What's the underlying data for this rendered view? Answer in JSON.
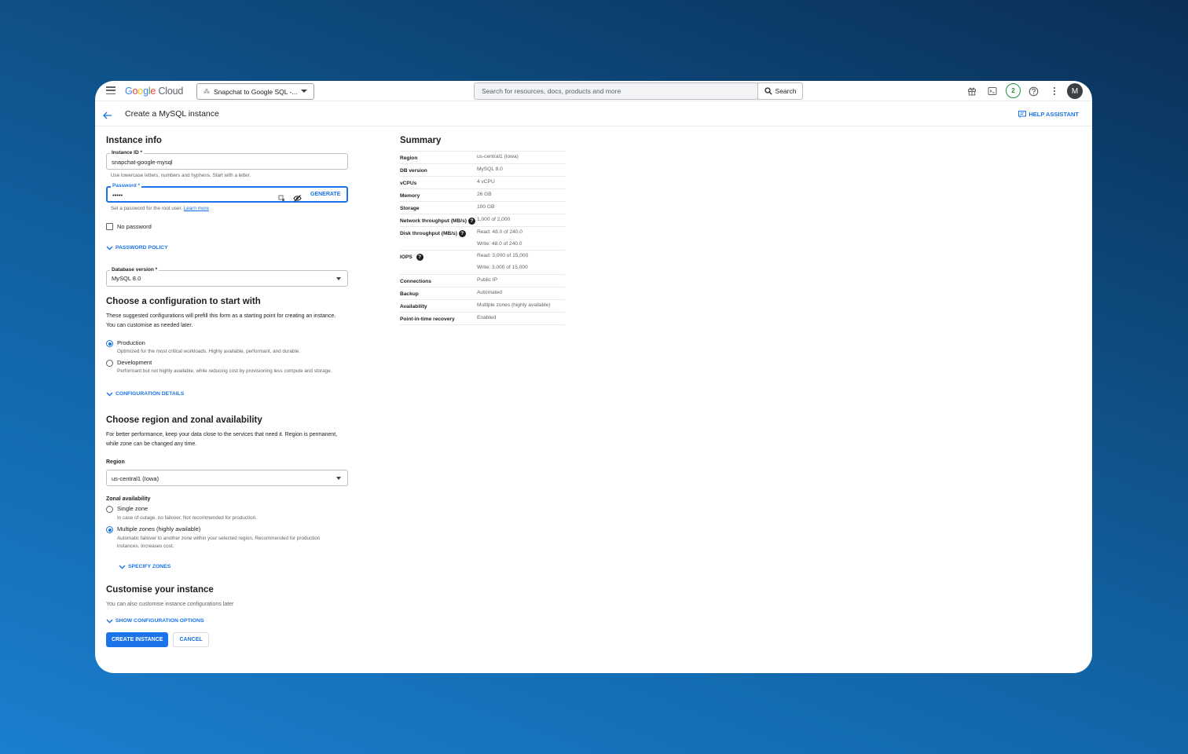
{
  "topbar": {
    "logo_google": "Google",
    "logo_cloud": "Cloud",
    "project": "Snapchat to Google SQL -...",
    "search_placeholder": "Search for resources, docs, products and more",
    "search_button": "Search",
    "notifications_count": "2",
    "avatar_letter": "M"
  },
  "page": {
    "title": "Create a MySQL instance",
    "help_assistant": "HELP ASSISTANT"
  },
  "instance_info": {
    "heading": "Instance info",
    "id_label": "Instance ID *",
    "id_value": "snapchat-google-mysql",
    "id_hint": "Use lowercase letters, numbers and hyphens. Start with a letter.",
    "password_label": "Password *",
    "password_value": "•••••",
    "generate": "GENERATE",
    "password_hint": "Set a password for the root user.",
    "learn_more": "Learn more",
    "no_password": "No password",
    "password_policy": "PASSWORD POLICY",
    "db_version_label": "Database version *",
    "db_version_value": "MySQL 8.0"
  },
  "config": {
    "heading": "Choose a configuration to start with",
    "description": "These suggested configurations will prefill this form as a starting point for creating an instance. You can customise as needed later.",
    "options": [
      {
        "label": "Production",
        "desc": "Optimized for the most critical workloads. Highly available, performant, and durable.",
        "selected": true
      },
      {
        "label": "Development",
        "desc": "Performant but not highly available, while reducing cost by provisioning less compute and storage.",
        "selected": false
      }
    ],
    "details": "CONFIGURATION DETAILS"
  },
  "region": {
    "heading": "Choose region and zonal availability",
    "description": "For better performance, keep your data close to the services that need it. Region is permanent, while zone can be changed any time.",
    "region_label": "Region",
    "region_value": "us-central1 (Iowa)",
    "zonal_label": "Zonal availability",
    "options": [
      {
        "label": "Single zone",
        "desc": "In case of outage, no failover. Not recommended for production.",
        "selected": false
      },
      {
        "label": "Multiple zones (highly available)",
        "desc": "Automatic failover to another zone within your selected region. Recommended for production instances. Increases cost.",
        "selected": true
      }
    ],
    "specify_zones": "SPECIFY ZONES"
  },
  "customise": {
    "heading": "Customise your instance",
    "description": "You can also customise instance configurations later",
    "show_options": "SHOW CONFIGURATION OPTIONS"
  },
  "actions": {
    "create": "CREATE INSTANCE",
    "cancel": "CANCEL"
  },
  "summary": {
    "heading": "Summary",
    "rows": [
      {
        "key": "Region",
        "values": [
          "us-central1 (Iowa)"
        ]
      },
      {
        "key": "DB version",
        "values": [
          "MySQL 8.0"
        ]
      },
      {
        "key": "vCPUs",
        "values": [
          "4 vCPU"
        ]
      },
      {
        "key": "Memory",
        "values": [
          "26 GB"
        ]
      },
      {
        "key": "Storage",
        "values": [
          "100 GB"
        ]
      },
      {
        "key": "Network throughput (MB/s)",
        "values": [
          "1,000 of 2,000"
        ],
        "help": true
      },
      {
        "key": "Disk throughput (MB/s)",
        "values": [
          "Read: 48.0 of 240.0",
          "Write: 48.0 of 240.0"
        ],
        "help": true
      },
      {
        "key": "IOPS",
        "values": [
          "Read: 3,000 of 15,000",
          "Write: 3,000 of 15,000"
        ],
        "help": true
      },
      {
        "key": "Connections",
        "values": [
          "Public IP"
        ]
      },
      {
        "key": "Backup",
        "values": [
          "Automated"
        ]
      },
      {
        "key": "Availability",
        "values": [
          "Multiple zones (highly available)"
        ]
      },
      {
        "key": "Point-in-time recovery",
        "values": [
          "Enabled"
        ]
      }
    ]
  }
}
